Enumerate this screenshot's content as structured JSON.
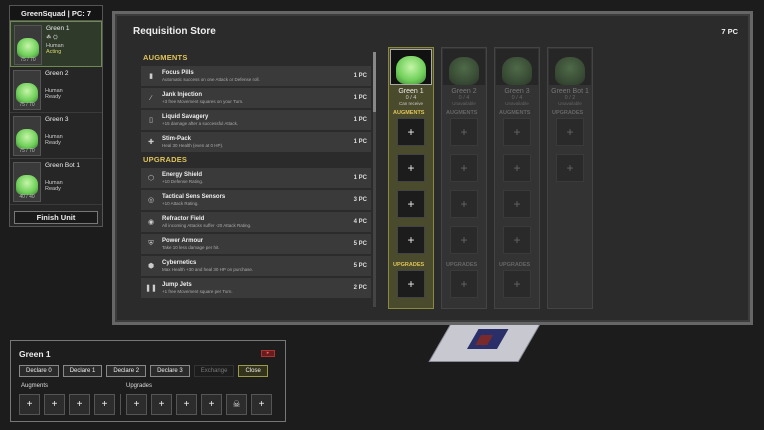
{
  "squad": {
    "title": "GreenSquad | PC: 7",
    "units": [
      {
        "name": "Green 1",
        "type": "Human",
        "status": "Acting",
        "hp": "75 / 70"
      },
      {
        "name": "Green 2",
        "type": "Human",
        "status": "Ready",
        "hp": "75 / 70"
      },
      {
        "name": "Green 3",
        "type": "Human",
        "status": "Ready",
        "hp": "75 / 70"
      },
      {
        "name": "Green Bot 1",
        "type": "Human",
        "status": "Ready",
        "hp": "40 / 40"
      }
    ],
    "finish_label": "Finish Unit"
  },
  "store": {
    "title": "Requisition Store",
    "pc": "7 PC",
    "augments_header": "AUGMENTS",
    "upgrades_header": "UPGRADES",
    "augments": [
      {
        "name": "Focus Pills",
        "desc": "Automatic success on one Attack or Defense roll.",
        "cost": "1 PC",
        "icon": "pill-icon",
        "glyph": "▮"
      },
      {
        "name": "Jank Injection",
        "desc": "+3 free Movement squares on your Turn.",
        "cost": "1 PC",
        "icon": "syringe-icon",
        "glyph": "∕"
      },
      {
        "name": "Liquid Savagery",
        "desc": "+15 damage after a successful Attack.",
        "cost": "1 PC",
        "icon": "vial-icon",
        "glyph": "▯"
      },
      {
        "name": "Stim-Pack",
        "desc": "Heal 30 Health (even at 0 HP).",
        "cost": "1 PC",
        "icon": "medkit-icon",
        "glyph": "✚"
      }
    ],
    "upgrades": [
      {
        "name": "Energy Shield",
        "desc": "+10 Defense Rating.",
        "cost": "1 PC",
        "icon": "shield-hex-icon",
        "glyph": "⬡"
      },
      {
        "name": "Tactical Sens Sensors",
        "desc": "+10 Attack Rating.",
        "cost": "3 PC",
        "icon": "sensor-icon",
        "glyph": "◎"
      },
      {
        "name": "Refractor Field",
        "desc": "All incoming Attacks suffer -20 Attack Rating.",
        "cost": "4 PC",
        "icon": "refractor-icon",
        "glyph": "◉"
      },
      {
        "name": "Power Armour",
        "desc": "Take 10 less damage per hit.",
        "cost": "5 PC",
        "icon": "armour-icon",
        "glyph": "⛨"
      },
      {
        "name": "Cybernetics",
        "desc": "Max Health +30 and heal 30 HP on purchase.",
        "cost": "5 PC",
        "icon": "cybernetics-icon",
        "glyph": "⬢"
      },
      {
        "name": "Jump Jets",
        "desc": "+1 free Movement square per Turn.",
        "cost": "2 PC",
        "icon": "jets-icon",
        "glyph": "❚❚"
      }
    ],
    "columns": [
      {
        "name": "Green 1",
        "count": "0 / 4",
        "status": "Can receive",
        "augments_label": "AUGMENTS",
        "upgrades_label": "UPGRADES"
      },
      {
        "name": "Green 2",
        "count": "0 / 4",
        "status": "Unavailable",
        "augments_label": "AUGMENTS",
        "upgrades_label": "UPGRADES"
      },
      {
        "name": "Green 3",
        "count": "0 / 4",
        "status": "Unavailable",
        "augments_label": "AUGMENTS",
        "upgrades_label": "UPGRADES"
      },
      {
        "name": "Green Bot 1",
        "count": "0 / 2",
        "status": "Unavailable",
        "augments_label": "UPGRADES",
        "upgrades_label": ""
      }
    ]
  },
  "panel": {
    "name": "Green 1",
    "buttons": [
      "Declare 0",
      "Declare 1",
      "Declare 2",
      "Declare 3",
      "Exchange",
      "Close"
    ],
    "augments_label": "Augments",
    "upgrades_label": "Upgrades",
    "plus": "+",
    "red_glyph": "▸",
    "face_glyph": "☠"
  }
}
